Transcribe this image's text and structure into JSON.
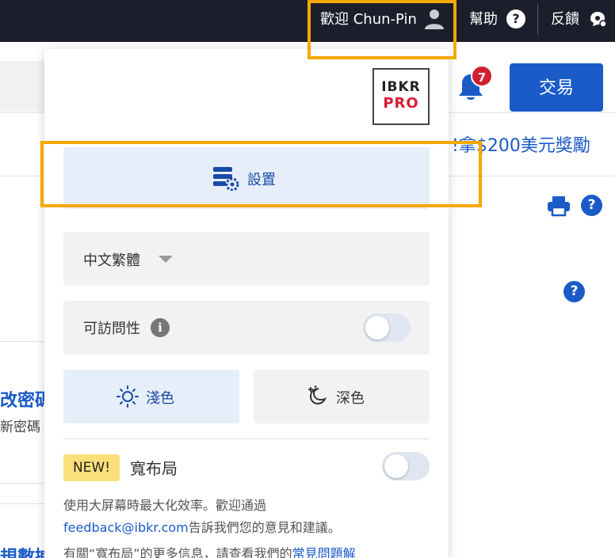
{
  "topbar": {
    "welcome": "歡迎 Chun-Pin",
    "help": "幫助",
    "help_icon_glyph": "?",
    "feedback": "反饋"
  },
  "background": {
    "notification_count": "7",
    "trade_button": "交易",
    "promo_text": "拿$200美元獎勵",
    "promo_prefix": "!",
    "change_password_title": "改密碼",
    "change_password_sub": "新密碼",
    "bottom_title": "規數據"
  },
  "menu": {
    "logo_top": "IBKR",
    "logo_bottom": "PRO",
    "settings_label": "設置",
    "language_selected": "中文繁體",
    "accessibility_label": "可訪問性",
    "accessibility_on": false,
    "theme_light": "淺色",
    "theme_dark": "深色",
    "selected_theme": "light",
    "new_badge": "NEW!",
    "wide_layout_label": "寬布局",
    "wide_layout_on": false,
    "desc_line1": "使用大屏幕時最大化效率。歡迎通過",
    "desc_link_email": "feedback@ibkr.com",
    "desc_line2_rest": "告訴我們您的意見和建議。",
    "desc_line3": "有關“寬布局”的更多信息，請查看我們的",
    "desc_link_faq": "常見問題解"
  },
  "colors": {
    "topbar_bg": "#1c1f2b",
    "accent_blue": "#1a5bc8",
    "highlight_orange": "#f5a800",
    "badge_red": "#d0202f",
    "new_badge_yellow": "#fbe07a"
  },
  "icons": [
    "user-icon",
    "help-icon",
    "feedback-icon",
    "bell-icon",
    "print-icon",
    "settings-icon",
    "info-icon",
    "sun-icon",
    "moon-icon",
    "caret-down-icon"
  ]
}
